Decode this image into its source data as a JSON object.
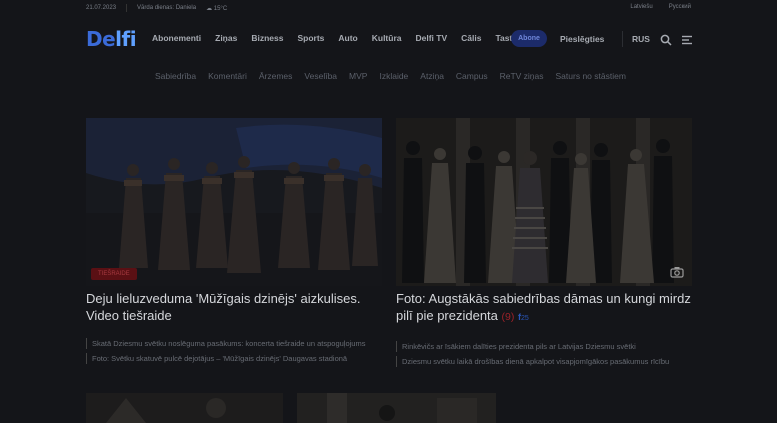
{
  "topbar": {
    "date": "21.07.2023",
    "name_days": "Vārda dienas: Daniela",
    "weather": "15°C",
    "right_links": [
      "Latviešu",
      "Русский"
    ]
  },
  "logo": {
    "text_a": "De",
    "text_b": "lfi"
  },
  "nav": {
    "items": [
      "Abonementi",
      "Ziņas",
      "Bizness",
      "Sports",
      "Auto",
      "Kultūra",
      "Delfi TV",
      "Cālis",
      "Tasty"
    ],
    "abone_label": "Abone",
    "login_label": "Pieslēgties",
    "lang_label": "RUS"
  },
  "subnav": {
    "items": [
      "Sabiedrība",
      "Komentāri",
      "Ārzemes",
      "Veselība",
      "MVP",
      "Izklaide",
      "Atziņa",
      "Campus",
      "ReTV ziņas",
      "Saturs no stāstiem"
    ]
  },
  "articles": [
    {
      "tag": "TIEŠRAIDE",
      "title": "Deju lieluzveduma 'Mūžīgais dzinējs' aizkulises. Video tiešraide",
      "related": [
        "Skatā Dziesmu svētku noslēguma pasākums: koncerta tiešraide un atspoguļojums",
        "Foto: Svētku skatuvē pulcē dejotājus – 'Mūžīgais dzinējs' Daugavas stadionā"
      ]
    },
    {
      "tag": "",
      "title": "Foto: Augstākās sabiedrības dāmas un kungi mirdz pilī pie prezidenta",
      "comments": "(9)",
      "fb": "25",
      "related": [
        "Rinkēvičs ar īsākiem dalīties prezidenta pils ar Latvijas Dziesmu svētki",
        "Dziesmu svētku laikā drošības dienā apkalpot visapjomīgākos pasākumus rīcību"
      ]
    }
  ]
}
